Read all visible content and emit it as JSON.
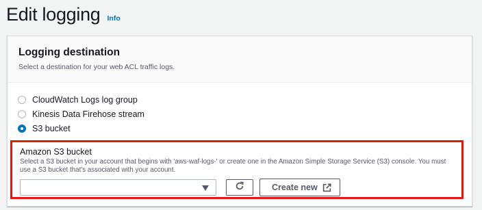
{
  "page": {
    "title": "Edit logging",
    "info_link": "Info"
  },
  "panel": {
    "title": "Logging destination",
    "description": "Select a destination for your web ACL traffic logs."
  },
  "destinations": {
    "options": [
      {
        "label": "CloudWatch Logs log group",
        "selected": false
      },
      {
        "label": "Kinesis Data Firehose stream",
        "selected": false
      },
      {
        "label": "S3 bucket",
        "selected": true
      }
    ]
  },
  "s3_bucket": {
    "label": "Amazon S3 bucket",
    "description": "Select a S3 bucket in your account that begins with 'aws-waf-logs-' or create one in the Amazon Simple Storage Service (S3) console. You must use a S3 bucket that's associated with your account.",
    "selected_value": "",
    "create_label": "Create new"
  },
  "icons": {
    "caret": "caret-down-icon",
    "refresh": "refresh-icon",
    "external": "external-link-icon"
  },
  "colors": {
    "accent": "#0073bb",
    "highlight_border": "#e0190f",
    "text_primary": "#16191f",
    "text_secondary": "#545b64"
  }
}
